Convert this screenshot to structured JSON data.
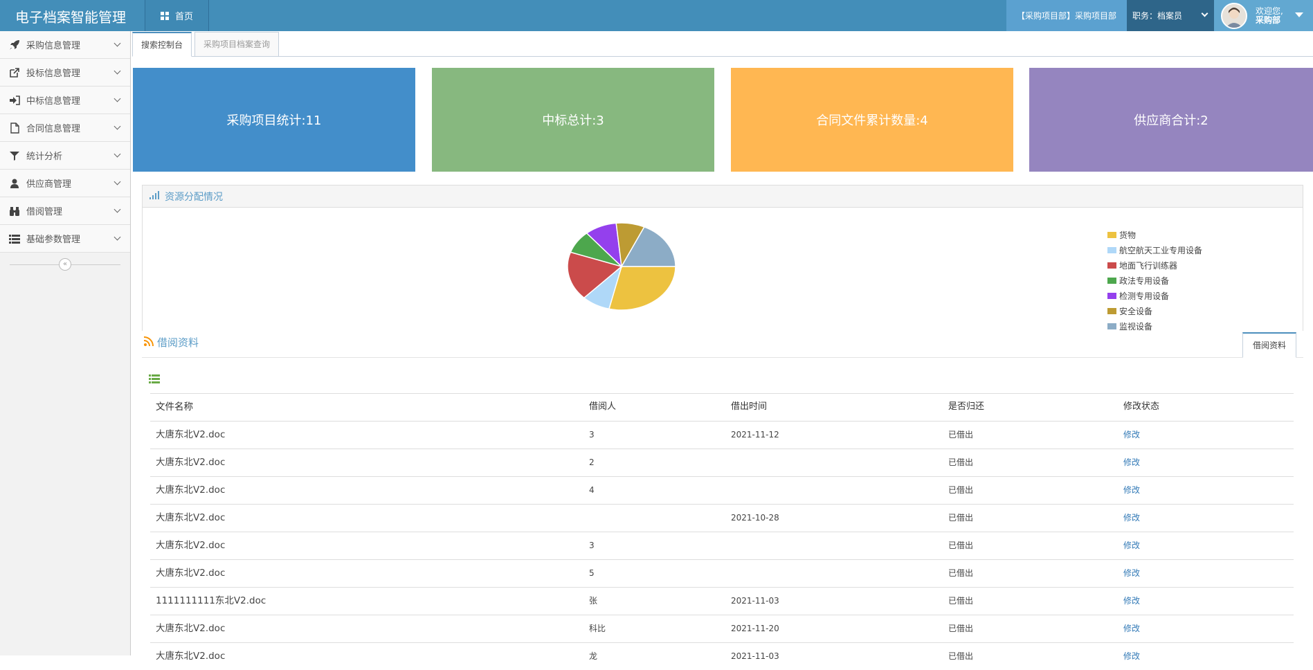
{
  "navbar": {
    "brand": "电子档案智能管理",
    "home_label": "首页",
    "dept": "【采购项目部】采购项目部",
    "role": "职务：档案员",
    "welcome": "欢迎您,",
    "user": "采购部"
  },
  "sidebar": {
    "items": [
      {
        "label": "采购信息管理",
        "icon": "rocket-icon"
      },
      {
        "label": "投标信息管理",
        "icon": "external-link-icon"
      },
      {
        "label": "中标信息管理",
        "icon": "sign-in-icon"
      },
      {
        "label": "合同信息管理",
        "icon": "file-icon"
      },
      {
        "label": "统计分析",
        "icon": "filter-icon"
      },
      {
        "label": "供应商管理",
        "icon": "user-icon"
      },
      {
        "label": "借阅管理",
        "icon": "binoculars-icon"
      },
      {
        "label": "基础参数管理",
        "icon": "list-icon"
      }
    ],
    "collapse": "«"
  },
  "tabs": [
    "搜索控制台",
    "采购项目档案查询"
  ],
  "tiles": [
    {
      "label": "采购项目统计:11",
      "color": "#438eca"
    },
    {
      "label": "中标总计:3",
      "color": "#87b87f"
    },
    {
      "label": "合同文件累计数量:4",
      "color": "#ffb752"
    },
    {
      "label": "供应商合计:2",
      "color": "#9585bf"
    }
  ],
  "chart_panel": {
    "title": "资源分配情况"
  },
  "chart_data": {
    "type": "pie",
    "labels": [
      "货物",
      "航空航天工业专用设备",
      "地面飞行训练器",
      "政法专用设备",
      "检测专用设备",
      "安全设备",
      "监视设备"
    ],
    "values": [
      27,
      8,
      17,
      8,
      9,
      8,
      17
    ],
    "colors": [
      "#edc240",
      "#afd8f8",
      "#cb4b4b",
      "#4da74d",
      "#9440ed",
      "#bd9b33",
      "#8cacc6"
    ],
    "legend_position": "right"
  },
  "borrow": {
    "title": "借阅资料",
    "tab": "借阅资料",
    "columns": [
      "文件名称",
      "借阅人",
      "借出时间",
      "是否归还",
      "修改状态"
    ],
    "rows": [
      [
        "大唐东北V2.doc",
        "3",
        "2021-11-12",
        "已借出",
        "修改"
      ],
      [
        "大唐东北V2.doc",
        "2",
        "",
        "已借出",
        "修改"
      ],
      [
        "大唐东北V2.doc",
        "4",
        "",
        "已借出",
        "修改"
      ],
      [
        "大唐东北V2.doc",
        "",
        "2021-10-28",
        "已借出",
        "修改"
      ],
      [
        "大唐东北V2.doc",
        "3",
        "",
        "已借出",
        "修改"
      ],
      [
        "大唐东北V2.doc",
        "5",
        "",
        "已借出",
        "修改"
      ],
      [
        "1111111111东北V2.doc",
        "张",
        "2021-11-03",
        "已借出",
        "修改"
      ],
      [
        "大唐东北V2.doc",
        "科比",
        "2021-11-20",
        "已借出",
        "修改"
      ],
      [
        "大唐东北V2.doc",
        "龙",
        "2021-11-03",
        "已借出",
        "修改"
      ]
    ]
  }
}
